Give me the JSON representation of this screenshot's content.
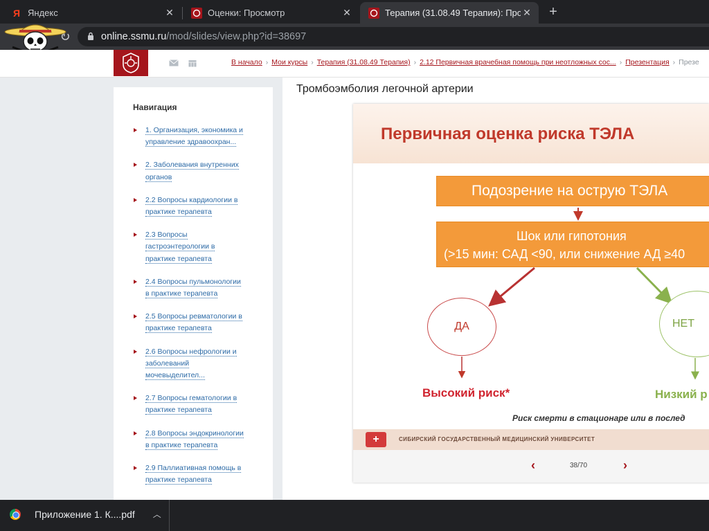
{
  "browser": {
    "tabs": [
      {
        "title": "Яндекс",
        "favicon": "yandex-icon",
        "active": false
      },
      {
        "title": "Оценки: Просмотр",
        "favicon": "ssmu-emblem-icon",
        "active": false
      },
      {
        "title": "Терапия (31.08.49 Терапия): Про",
        "favicon": "ssmu-emblem-icon",
        "active": true
      }
    ],
    "url_host": "online.ssmu.ru",
    "url_path": "/mod/slides/view.php?id=38697",
    "colors": {
      "tabbar": "#202124",
      "active_tab": "#35363a"
    }
  },
  "site": {
    "accent": "#a5151c",
    "breadcrumb": [
      "В начало",
      "Мои курсы",
      "Терапия (31.08.49 Терапия)",
      "2.12 Первичная врачебная помощь при неотложных сос...",
      "Презентация"
    ],
    "breadcrumb_last": "Презе"
  },
  "nav": {
    "title": "Навигация",
    "items": [
      [
        "1. Организация, экономика и",
        "управление здравоохран..."
      ],
      [
        "2. Заболевания внутренних",
        "органов"
      ],
      [
        "2.2 Вопросы кардиологии в",
        "практике терапевта"
      ],
      [
        "2.3 Вопросы",
        "гастроэнтерологии в",
        "практике терапевта"
      ],
      [
        "2.4 Вопросы пульмонологии",
        "в практике терапевта"
      ],
      [
        "2.5 Вопросы ревматологии в",
        "практике терапевта"
      ],
      [
        "2.6 Вопросы нефрологии и",
        "заболеваний",
        "мочевыделител..."
      ],
      [
        "2.7 Вопросы гематологии в",
        "практике терапевта"
      ],
      [
        "2.8 Вопросы эндокринологии",
        "в практике терапевта"
      ],
      [
        "2.9 Паллиативная помощь в",
        "практике терапевта"
      ]
    ]
  },
  "page": {
    "title": "Тромбоэмболия легочной артерии"
  },
  "slide": {
    "heading": "Первичная оценка риска ТЭЛА",
    "box1": "Подозрение на острую ТЭЛА",
    "box2_line1": "Шок или гипотония",
    "box2_line2": "(>15 мин: САД <90, или снижение АД ≥40",
    "yes": "ДА",
    "no": "НЕТ",
    "high_risk": "Высокий риск*",
    "low_risk": "Низкий р",
    "note": "Риск смерти в стационаре или в послед",
    "university": "СИБИРСКИЙ ГОСУДАРСТВЕННЫЙ МЕДИЦИНСКИЙ УНИВЕРСИТЕТ",
    "colors": {
      "orange": "#f39a3a",
      "red": "#c0392b",
      "green": "#8ab14d"
    }
  },
  "pager": {
    "page": "38/70",
    "prev": "‹",
    "next": "›"
  },
  "downloads": {
    "file": "Приложение 1. К....pdf"
  }
}
